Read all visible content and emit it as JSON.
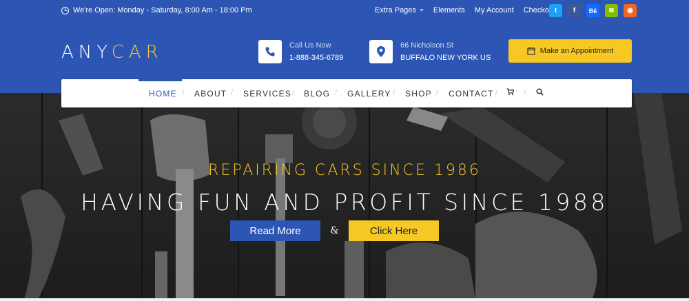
{
  "topbar": {
    "hours": "We're Open: Monday - Saturday, 8:00 Am - 18:00 Pm",
    "links": [
      {
        "label": "Extra Pages",
        "dropdown": true
      },
      {
        "label": "Elements"
      },
      {
        "label": "My Account"
      },
      {
        "label": "Checkout"
      }
    ],
    "social": [
      {
        "name": "twitter-icon",
        "glyph": "t",
        "color": "#1da1f2"
      },
      {
        "name": "facebook-icon",
        "glyph": "f",
        "color": "#3b5998"
      },
      {
        "name": "behance-icon",
        "glyph": "Bē",
        "color": "#1769ff"
      },
      {
        "name": "spotify-icon",
        "glyph": "≋",
        "color": "#84bd00"
      },
      {
        "name": "rss-icon",
        "glyph": "◉",
        "color": "#f26522"
      }
    ]
  },
  "header": {
    "logo_main": "ANY",
    "logo_accent": "CAR",
    "phone_label": "Call Us Now",
    "phone_value": "1-888-345-6789",
    "address_line1": "66 Nicholson St",
    "address_line2": "BUFFALO NEW YORK US",
    "appointment_label": "Make an Appointment"
  },
  "nav": {
    "items": [
      "HOME",
      "ABOUT",
      "SERVICES",
      "BLOG",
      "GALLERY",
      "SHOP",
      "CONTACT"
    ],
    "active": "HOME",
    "cart_icon": "cart-icon",
    "search_icon": "search-icon"
  },
  "hero": {
    "subtitle": "REPAIRING CARS SINCE 1986",
    "title": "HAVING FUN AND PROFIT SINCE 1988",
    "primary_button": "Read More",
    "separator": "&",
    "secondary_button": "Click Here"
  },
  "colors": {
    "brand_blue": "#2d56b4",
    "accent_yellow": "#f7c823"
  }
}
